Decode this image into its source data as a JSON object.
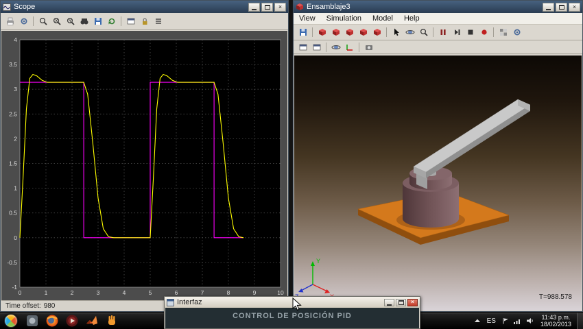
{
  "scope": {
    "title": "Scope",
    "toolbar": [
      "print",
      "parameters",
      "|",
      "zoom",
      "zoom-x",
      "zoom-y",
      "autoscale",
      "save-axes",
      "restore-axes",
      "|",
      "floating-scope",
      "lock-axes",
      "signal-selection"
    ],
    "status_label": "Time offset:",
    "status_value": "980"
  },
  "chart_data": {
    "type": "line",
    "xlabel": "",
    "ylabel": "",
    "xlim": [
      0,
      10
    ],
    "ylim": [
      -1,
      4
    ],
    "x_ticks": [
      0,
      1,
      2,
      3,
      4,
      5,
      6,
      7,
      8,
      9,
      10
    ],
    "y_ticks": [
      -1,
      -0.5,
      0,
      0.5,
      1,
      1.5,
      2,
      2.5,
      3,
      3.5,
      4
    ],
    "grid": true,
    "background": "#000000",
    "series": [
      {
        "name": "magenta-square-wave",
        "color": "#ff00ff",
        "points": [
          [
            0,
            3.14
          ],
          [
            2.45,
            3.14
          ],
          [
            2.45,
            0
          ],
          [
            5,
            0
          ],
          [
            5,
            3.14
          ],
          [
            7.45,
            3.14
          ],
          [
            7.45,
            0
          ],
          [
            8.58,
            0
          ]
        ]
      },
      {
        "name": "yellow-response",
        "color": "#ffff00",
        "points": [
          [
            0,
            0
          ],
          [
            0.12,
            1.2
          ],
          [
            0.25,
            2.6
          ],
          [
            0.38,
            3.22
          ],
          [
            0.5,
            3.3
          ],
          [
            0.65,
            3.27
          ],
          [
            0.85,
            3.18
          ],
          [
            1.05,
            3.14
          ],
          [
            2.45,
            3.14
          ],
          [
            2.6,
            2.9
          ],
          [
            2.8,
            1.9
          ],
          [
            3.0,
            0.8
          ],
          [
            3.2,
            0.18
          ],
          [
            3.4,
            0.02
          ],
          [
            3.6,
            0
          ],
          [
            5,
            0
          ],
          [
            5.12,
            1.2
          ],
          [
            5.25,
            2.6
          ],
          [
            5.38,
            3.22
          ],
          [
            5.5,
            3.3
          ],
          [
            5.65,
            3.27
          ],
          [
            5.85,
            3.18
          ],
          [
            6.05,
            3.14
          ],
          [
            7.45,
            3.14
          ],
          [
            7.6,
            2.9
          ],
          [
            7.8,
            1.9
          ],
          [
            8.0,
            0.8
          ],
          [
            8.2,
            0.18
          ],
          [
            8.4,
            0.02
          ],
          [
            8.58,
            0
          ]
        ]
      }
    ]
  },
  "model_window": {
    "title": "Ensamblaje3",
    "menu": [
      "View",
      "Simulation",
      "Model",
      "Help"
    ],
    "toolbar_row1": [
      "save",
      "|",
      "cube-1",
      "cube-2",
      "cube-3",
      "cube-4",
      "cube-5",
      "|",
      "select",
      "orbit",
      "zoom",
      "|",
      "pause",
      "step",
      "stop",
      "record",
      "|",
      "grid",
      "layout"
    ],
    "toolbar_row2": [
      "view-box",
      "view-box2",
      "|",
      "orbit2",
      "axes",
      "|",
      "camera"
    ],
    "sim_time": "T=988.578",
    "axis_labels": {
      "x": "X",
      "y": "Y",
      "z": "Z"
    },
    "colors": {
      "plate": "#d4791c",
      "plate_side": "#8f4e0e",
      "cylinder": "#6e5154",
      "arm": "#c9c9c9"
    }
  },
  "interfaz": {
    "title": "Interfaz",
    "heading": "CONTROL DE POSICIÓN PID"
  },
  "taskbar": {
    "app_icons": [
      "app-generic",
      "browser",
      "media-app",
      "matlab",
      "hand-tool"
    ],
    "tray_icons": [
      "flag",
      "network",
      "volume"
    ],
    "tray_language": "ES",
    "tray_time": "11:43 p.m.",
    "tray_date": "18/02/2013"
  }
}
